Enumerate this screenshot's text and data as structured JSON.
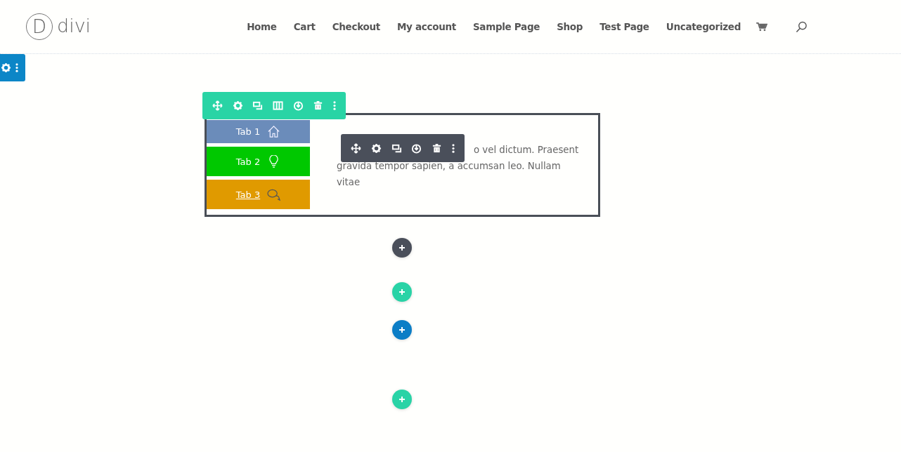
{
  "logo": {
    "letter": "D",
    "text": "divi"
  },
  "nav": [
    {
      "label": "Home"
    },
    {
      "label": "Cart"
    },
    {
      "label": "Checkout"
    },
    {
      "label": "My account"
    },
    {
      "label": "Sample Page"
    },
    {
      "label": "Shop"
    },
    {
      "label": "Test Page"
    },
    {
      "label": "Uncategorized"
    }
  ],
  "tabs": [
    {
      "label": "Tab 1",
      "color": "#6b8cba",
      "underlined": false
    },
    {
      "label": "Tab 2",
      "color": "#00c800",
      "underlined": false
    },
    {
      "label": "Tab 3",
      "color": "#e09a00",
      "underlined": true
    }
  ],
  "content": {
    "line_1_end": "o vel dictum. Praesent",
    "line_2": "gravida tempor sapien, a accumsan leo. Nullam",
    "line_3": "vitae"
  },
  "add_buttons": [
    {
      "kind": "module"
    },
    {
      "kind": "row"
    },
    {
      "kind": "section"
    },
    {
      "kind": "row"
    }
  ]
}
